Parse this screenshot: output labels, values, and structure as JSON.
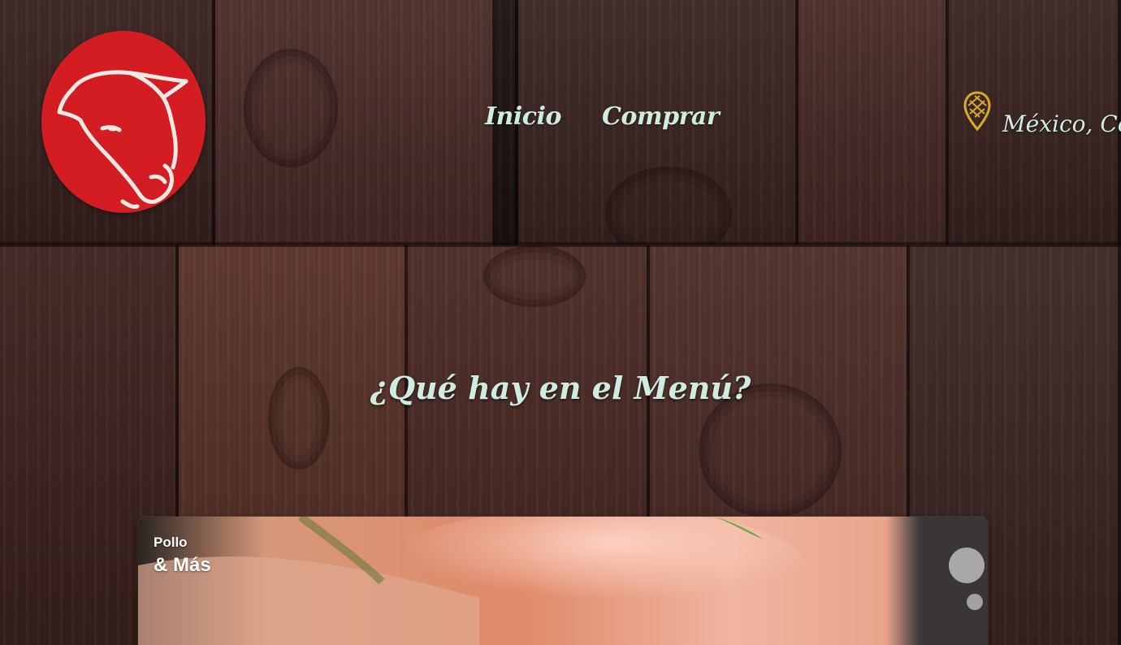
{
  "colors": {
    "wood_base": "#4a2c26",
    "brand_red": "#d41d22",
    "text_mint": "#cfece0",
    "pin_gold": "#d9a92a"
  },
  "header": {
    "logo_icon": "bull-head-icon",
    "nav": [
      {
        "label": "Inicio"
      },
      {
        "label": "Comprar"
      }
    ],
    "location": {
      "icon": "map-pin-icon",
      "text": "México, Coah"
    }
  },
  "main": {
    "heading": "¿Qué hay en el Menú?",
    "card": {
      "label_top": "Pollo",
      "label_bottom": "& Más"
    }
  }
}
